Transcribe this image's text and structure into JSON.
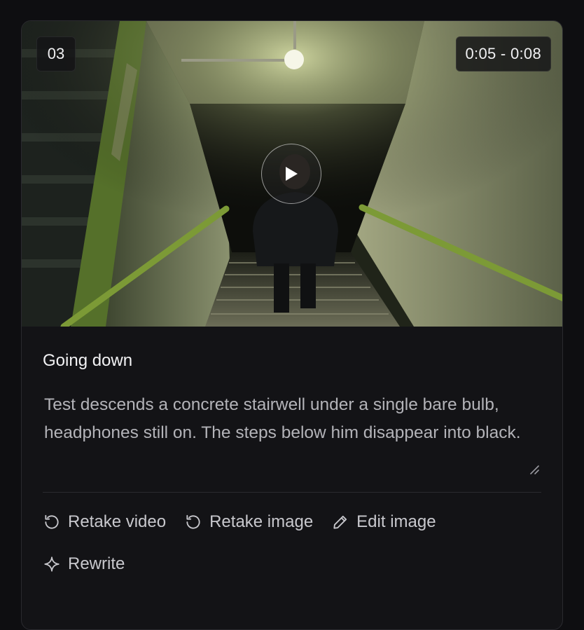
{
  "scene": {
    "number": "03",
    "time_range": "0:05 - 0:08",
    "title": "Going down",
    "description": "Test descends a concrete stairwell under a single bare bulb, headphones still on. The steps below him disappear into black."
  },
  "actions": {
    "retake_video": "Retake video",
    "retake_image": "Retake image",
    "edit_image": "Edit image",
    "rewrite": "Rewrite"
  },
  "icons": {
    "play": "play-icon",
    "retake_video": "rotate-ccw-icon",
    "retake_image": "rotate-ccw-icon",
    "edit_image": "pencil-icon",
    "rewrite": "sparkle-icon",
    "resize": "resize-handle-icon"
  },
  "colors": {
    "background": "#0e0e11",
    "card": "#131316",
    "text_primary": "#f2f2f4",
    "text_secondary": "#b3b3b8",
    "railing_green": "#6f8a2f"
  }
}
